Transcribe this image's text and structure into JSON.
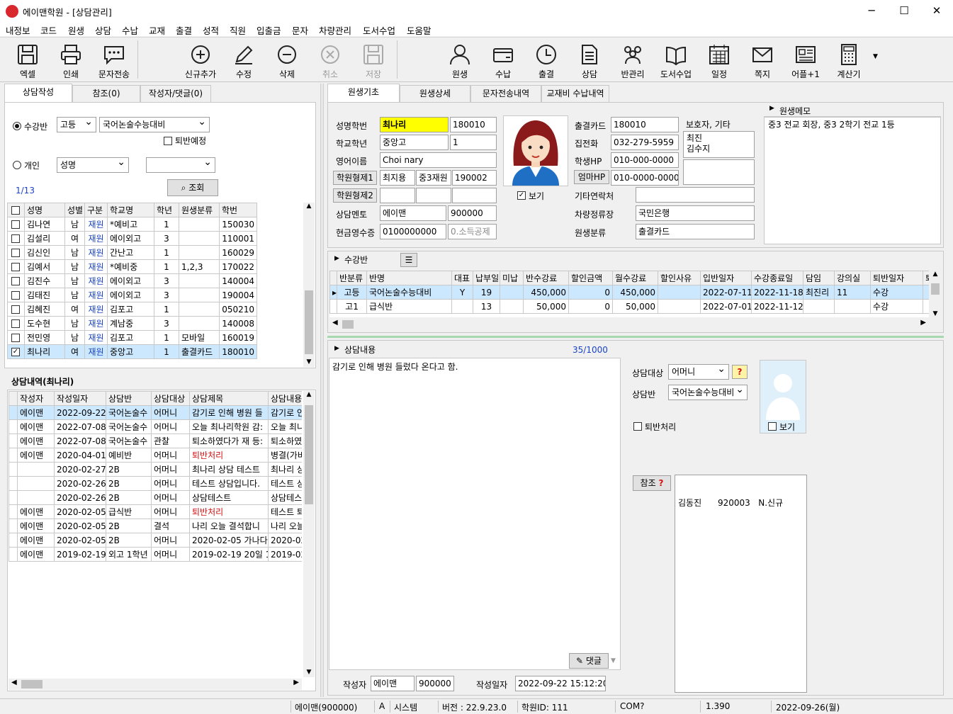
{
  "window": {
    "title": "에이맨학원 - [상담관리]"
  },
  "menu": [
    "내정보",
    "코드",
    "원생",
    "상담",
    "수납",
    "교재",
    "출결",
    "성적",
    "직원",
    "입출금",
    "문자",
    "차량관리",
    "도서수업",
    "도움말"
  ],
  "toolbar": {
    "excel": "엑셀",
    "print": "인쇄",
    "sms": "문자전송",
    "add": "신규추가",
    "edit": "수정",
    "delete": "삭제",
    "cancel": "취소",
    "save": "저장",
    "student": "원생",
    "payment": "수납",
    "attendance": "출결",
    "counsel": "상담",
    "class_mgmt": "반관리",
    "book_class": "도서수업",
    "schedule": "일정",
    "note": "쪽지",
    "app": "어플+1",
    "calc": "계산기"
  },
  "left": {
    "tabs": [
      "상담작성",
      "참조(0)",
      "작성자/댓글(0)"
    ],
    "filter": {
      "class_radio": "수강반",
      "level": "고등",
      "class": "국어논술수능대비",
      "quit_check": "퇴반예정",
      "individual_radio": "개인",
      "search_field": "성명",
      "search_value": "",
      "search_button": "조회",
      "count": "1/13"
    },
    "students": {
      "headers": [
        "성명",
        "성별",
        "구분",
        "학교명",
        "학년",
        "원생분류",
        "학번"
      ],
      "rows": [
        [
          "김나연",
          "남",
          "재원",
          "*예비고",
          "1",
          "",
          "150030"
        ],
        [
          "김설리",
          "여",
          "재원",
          "에이외고",
          "3",
          "",
          "110001"
        ],
        [
          "김신인",
          "남",
          "재원",
          "간난고",
          "1",
          "",
          "160029"
        ],
        [
          "김예서",
          "남",
          "재원",
          "*예비중",
          "1",
          "1,2,3",
          "170022"
        ],
        [
          "김진수",
          "남",
          "재원",
          "에이외고",
          "3",
          "",
          "140004"
        ],
        [
          "김태진",
          "남",
          "재원",
          "에이외고",
          "3",
          "",
          "190004"
        ],
        [
          "김혜진",
          "여",
          "재원",
          "김포고",
          "1",
          "",
          "050210"
        ],
        [
          "도수현",
          "남",
          "재원",
          "계남중",
          "3",
          "",
          "140008"
        ],
        [
          "전민영",
          "남",
          "재원",
          "김포고",
          "1",
          "모바일",
          "160019"
        ],
        [
          "최나리",
          "여",
          "재원",
          "중앙고",
          "1",
          "출결카드",
          "180010"
        ]
      ]
    },
    "history": {
      "title": "상담내역(최나리)",
      "headers": [
        "작성자",
        "작성일자",
        "상담반",
        "상담대상",
        "상담제목",
        "상담내용"
      ],
      "rows": [
        [
          "에이맨",
          "2022-09-22",
          "국어논술수",
          "어머니",
          "감기로 인해 병원 들",
          "감기로 인"
        ],
        [
          "에이맨",
          "2022-07-08",
          "국어논술수",
          "어머니",
          "오늘 최나리학원 감:",
          "오늘 최니"
        ],
        [
          "에이맨",
          "2022-07-08",
          "국어논술수",
          "관찰",
          "퇴소하였다가 재 등:",
          "퇴소하였"
        ],
        [
          "에이맨",
          "2020-04-01",
          "예비반",
          "어머니",
          "퇴반처리",
          "병결(가비"
        ],
        [
          "",
          "2020-02-27",
          "2B",
          "어머니",
          "최나리 상담 테스트",
          "최나리 상"
        ],
        [
          "",
          "2020-02-26",
          "2B",
          "어머니",
          "테스트 상담입니다.",
          "테스트 상"
        ],
        [
          "",
          "2020-02-26",
          "2B",
          "어머니",
          "상담테스트",
          "상담테스"
        ],
        [
          "에이맨",
          "2020-02-05",
          "급식반",
          "어머니",
          "퇴반처리",
          "테스트 퇴"
        ],
        [
          "에이맨",
          "2020-02-05",
          "2B",
          "결석",
          "나리 오늘 결석합니",
          "나리 오늘"
        ],
        [
          "에이맨",
          "2020-02-05",
          "2B",
          "어머니",
          "2020-02-05 가나다",
          "2020-02"
        ],
        [
          "에이맨",
          "2019-02-19",
          "외고 1학년",
          "어머니",
          "2019-02-19 20일 1",
          "2019-02"
        ]
      ]
    }
  },
  "right": {
    "tabs": [
      "원생기초",
      "원생상세",
      "문자전송내역",
      "교재비 수납내역"
    ],
    "basic": {
      "name_label": "성명학번",
      "name": "최나리",
      "student_no": "180010",
      "school_label": "학교학년",
      "school": "중앙고",
      "grade": "1",
      "eng_label": "영어이름",
      "eng_name": "Choi nary",
      "sibling1_label": "학원형제1",
      "sibling1_name": "최지용",
      "sibling1_class": "중3재원",
      "sibling1_no": "190002",
      "sibling2_label": "학원형제2",
      "mentor_label": "상담멘토",
      "mentor": "에이맨",
      "mentor_no": "900000",
      "receipt_label": "현금영수증",
      "receipt": "0100000000",
      "receipt_type": "0.소득공제",
      "view_photo": "보기",
      "card_label": "출결카드",
      "card": "180010",
      "home_label": "집전화",
      "home": "032-279-5959",
      "hp_label": "학생HP",
      "hp": "010-000-0000",
      "mom_label": "엄마HP",
      "mom_hp": "010-0000-0000",
      "guardian_label": "보호자, 기타",
      "guardian_line1": "최진",
      "guardian_line2": "김수지",
      "other_label": "기타연락처",
      "other": "",
      "bus_label": "차량정류장",
      "bus": "국민은행",
      "category_label": "원생분류",
      "category": "출결카드",
      "memo_label": "원생메모",
      "memo": "중3 전교 회장, 중3 2학기 전교 1등"
    },
    "classes": {
      "title": "수강반",
      "headers": [
        "반분류",
        "반명",
        "대표",
        "납부일",
        "미납",
        "반수강료",
        "할인금액",
        "월수강료",
        "할인사유",
        "입반일자",
        "수강종료일",
        "담임",
        "강의실",
        "퇴반일자",
        "퇴"
      ],
      "rows": [
        [
          "고등",
          "국어논술수능대비",
          "Y",
          "19",
          "",
          "450,000",
          "0",
          "450,000",
          "",
          "2022-07-11",
          "2022-11-18",
          "최진리",
          "11",
          "수강",
          ""
        ],
        [
          "고1",
          "급식반",
          "",
          "13",
          "",
          "50,000",
          "0",
          "50,000",
          "",
          "2022-07-01",
          "2022-11-12",
          "",
          "",
          "수강",
          ""
        ]
      ]
    },
    "counsel": {
      "title": "상담내용",
      "count": "35/1000",
      "content": "감기로 인해 병원 들렀다 온다고 함.",
      "reply": "댓글",
      "target_label": "상담대상",
      "target": "어머니",
      "class_label": "상담반",
      "class": "국어논술수능대비",
      "quit_label": "퇴반처리",
      "view_photo": "보기",
      "ref_label": "참조",
      "ref_item": "김동진      920003   N.신규",
      "writer_label": "작성자",
      "writer": "에이맨",
      "writer_no": "900000",
      "date_label": "작성일자",
      "date": "2022-09-22 15:12:20"
    }
  },
  "statusbar": {
    "user": "에이맨(900000)",
    "mode": "A",
    "role": "시스템",
    "version": "버전 : 22.9.23.0",
    "academy": "학원ID: 111",
    "com": "COM?",
    "val": "1.390",
    "date": "2022-09-26(월)"
  }
}
